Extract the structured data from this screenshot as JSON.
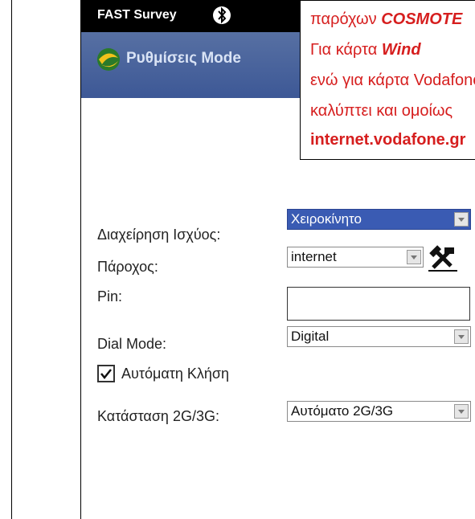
{
  "statusbar": {
    "app_name": "FAST Survey"
  },
  "titlebar": {
    "title": "Ρυθμίσεις Mode"
  },
  "form": {
    "power": {
      "label": "Διαχείρηση Ισχύος:",
      "value": "Χειροκίνητο"
    },
    "provider": {
      "label": "Πάροχος:",
      "value": "internet"
    },
    "pin": {
      "label": "Pin:",
      "value": ""
    },
    "dial_mode": {
      "label": "Dial Mode:",
      "value": "Digital"
    },
    "auto_dial": {
      "label": "Αυτόματη Κλήση",
      "checked": true
    },
    "network_mode": {
      "label": "Κατάσταση 2G/3G:",
      "value": "Αυτόματο 2G/3G"
    }
  },
  "callout": {
    "line1_prefix": "παρόχων ",
    "line1_emph": "COSMOTE",
    "line2_prefix": "Για κάρτα ",
    "line2_emph": "Wind",
    "line3": "ενώ για κάρτα Vodafone",
    "line4": "καλύπτει και ομοίως",
    "line5": "internet.vodafone.gr"
  },
  "colors": {
    "title_bar": "#3d5896",
    "selected_combo": "#3a5bb3",
    "callout_text": "#d61e1e"
  }
}
